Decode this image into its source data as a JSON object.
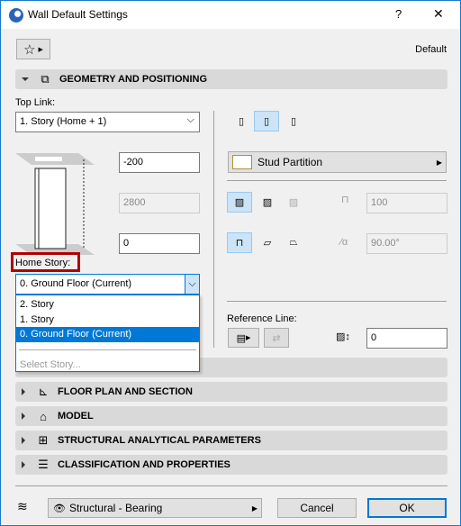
{
  "window": {
    "title": "Wall Default Settings",
    "help": "?",
    "close": "✕"
  },
  "favorites": {
    "default_label": "Default"
  },
  "geometry": {
    "title": "GEOMETRY AND POSITIONING",
    "top_link_label": "Top Link:",
    "top_link_value": "1. Story (Home + 1)",
    "top_offset": "-200",
    "height": "2800",
    "base_offset": "0",
    "home_story_label": "Home Story:",
    "home_story_value": "0. Ground Floor (Current)",
    "home_story_options": [
      "2. Story",
      "1. Story",
      "0. Ground Floor (Current)"
    ],
    "select_story": "Select Story...",
    "composite": "Stud Partition",
    "thickness": "100",
    "slant_angle": "90.00°",
    "reference_line_label": "Reference Line:",
    "reference_offset": "0"
  },
  "sections": [
    {
      "title": "FLOOR PLAN AND SECTION"
    },
    {
      "title": "MODEL"
    },
    {
      "title": "STRUCTURAL ANALYTICAL PARAMETERS"
    },
    {
      "title": "CLASSIFICATION AND PROPERTIES"
    }
  ],
  "footer": {
    "layer": "Structural - Bearing",
    "cancel": "Cancel",
    "ok": "OK"
  },
  "colors": {
    "accent": "#0078d7",
    "highlight_box": "#b00000",
    "header_bg": "#d9d9d9"
  }
}
